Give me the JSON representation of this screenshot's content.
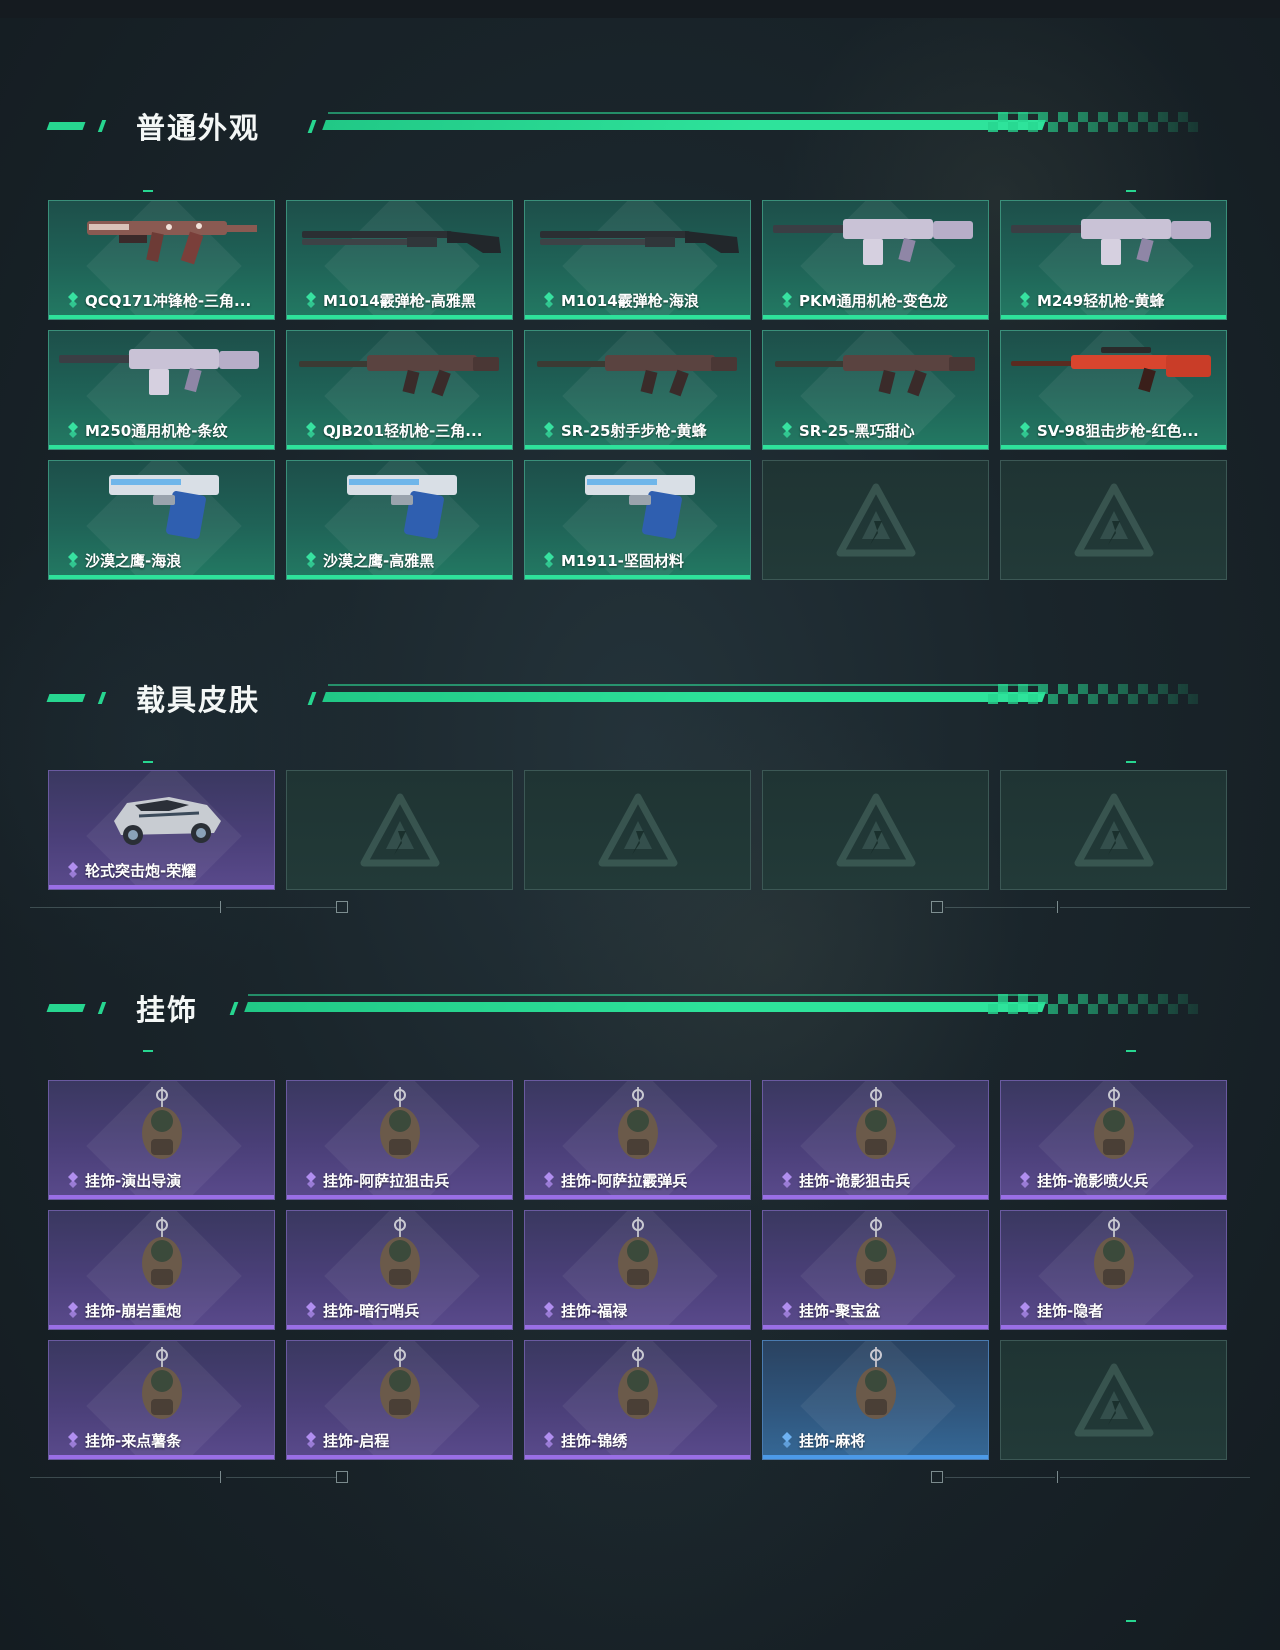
{
  "colors": {
    "accent": "#2ee39b",
    "rarity_green": "#2ee39b",
    "rarity_purple": "#9a6fe6",
    "rarity_blue": "#4c9ae8"
  },
  "sections": [
    {
      "id": "weapon-skins",
      "title": "普通外观",
      "items": [
        {
          "label": "QCQ171冲锋枪-三角...",
          "rarity": "green",
          "icon": "smg-icon"
        },
        {
          "label": "M1014霰弹枪-高雅黑",
          "rarity": "green",
          "icon": "shotgun-icon"
        },
        {
          "label": "M1014霰弹枪-海浪",
          "rarity": "green",
          "icon": "shotgun-icon"
        },
        {
          "label": "PKM通用机枪-变色龙",
          "rarity": "green",
          "icon": "machine-gun-icon"
        },
        {
          "label": "M249轻机枪-黄蜂",
          "rarity": "green",
          "icon": "machine-gun-icon"
        },
        {
          "label": "M250通用机枪-条纹",
          "rarity": "green",
          "icon": "machine-gun-icon"
        },
        {
          "label": "QJB201轻机枪-三角...",
          "rarity": "green",
          "icon": "rifle-icon"
        },
        {
          "label": "SR-25射手步枪-黄蜂",
          "rarity": "green",
          "icon": "rifle-icon"
        },
        {
          "label": "SR-25-黑巧甜心",
          "rarity": "green",
          "icon": "rifle-icon"
        },
        {
          "label": "SV-98狙击步枪-红色...",
          "rarity": "green",
          "icon": "sniper-icon"
        },
        {
          "label": "沙漠之鹰-海浪",
          "rarity": "green",
          "icon": "pistol-icon"
        },
        {
          "label": "沙漠之鹰-高雅黑",
          "rarity": "green",
          "icon": "pistol-icon"
        },
        {
          "label": "M1911-坚固材料",
          "rarity": "green",
          "icon": "pistol-icon"
        },
        {
          "label": "",
          "rarity": "empty",
          "icon": "placeholder-logo-icon"
        },
        {
          "label": "",
          "rarity": "empty",
          "icon": "placeholder-logo-icon"
        }
      ]
    },
    {
      "id": "vehicle-skins",
      "title": "载具皮肤",
      "items": [
        {
          "label": "轮式突击炮-荣耀",
          "rarity": "purple",
          "icon": "vehicle-icon"
        },
        {
          "label": "",
          "rarity": "empty",
          "icon": "placeholder-logo-icon"
        },
        {
          "label": "",
          "rarity": "empty",
          "icon": "placeholder-logo-icon"
        },
        {
          "label": "",
          "rarity": "empty",
          "icon": "placeholder-logo-icon"
        },
        {
          "label": "",
          "rarity": "empty",
          "icon": "placeholder-logo-icon"
        }
      ]
    },
    {
      "id": "charms",
      "title": "挂饰",
      "items": [
        {
          "label": "挂饰-演出导演",
          "rarity": "purple",
          "icon": "charm-icon"
        },
        {
          "label": "挂饰-阿萨拉狙击兵",
          "rarity": "purple",
          "icon": "charm-icon"
        },
        {
          "label": "挂饰-阿萨拉霰弹兵",
          "rarity": "purple",
          "icon": "charm-icon"
        },
        {
          "label": "挂饰-诡影狙击兵",
          "rarity": "purple",
          "icon": "charm-icon"
        },
        {
          "label": "挂饰-诡影喷火兵",
          "rarity": "purple",
          "icon": "charm-icon"
        },
        {
          "label": "挂饰-崩岩重炮",
          "rarity": "purple",
          "icon": "charm-icon"
        },
        {
          "label": "挂饰-暗行哨兵",
          "rarity": "purple",
          "icon": "charm-icon"
        },
        {
          "label": "挂饰-福禄",
          "rarity": "purple",
          "icon": "charm-icon"
        },
        {
          "label": "挂饰-聚宝盆",
          "rarity": "purple",
          "icon": "charm-icon"
        },
        {
          "label": "挂饰-隐者",
          "rarity": "purple",
          "icon": "charm-icon"
        },
        {
          "label": "挂饰-来点薯条",
          "rarity": "purple",
          "icon": "charm-icon"
        },
        {
          "label": "挂饰-启程",
          "rarity": "purple",
          "icon": "charm-icon"
        },
        {
          "label": "挂饰-锦绣",
          "rarity": "purple",
          "icon": "charm-icon"
        },
        {
          "label": "挂饰-麻将",
          "rarity": "blue",
          "icon": "charm-icon"
        },
        {
          "label": "",
          "rarity": "empty",
          "icon": "placeholder-logo-icon"
        }
      ]
    }
  ]
}
